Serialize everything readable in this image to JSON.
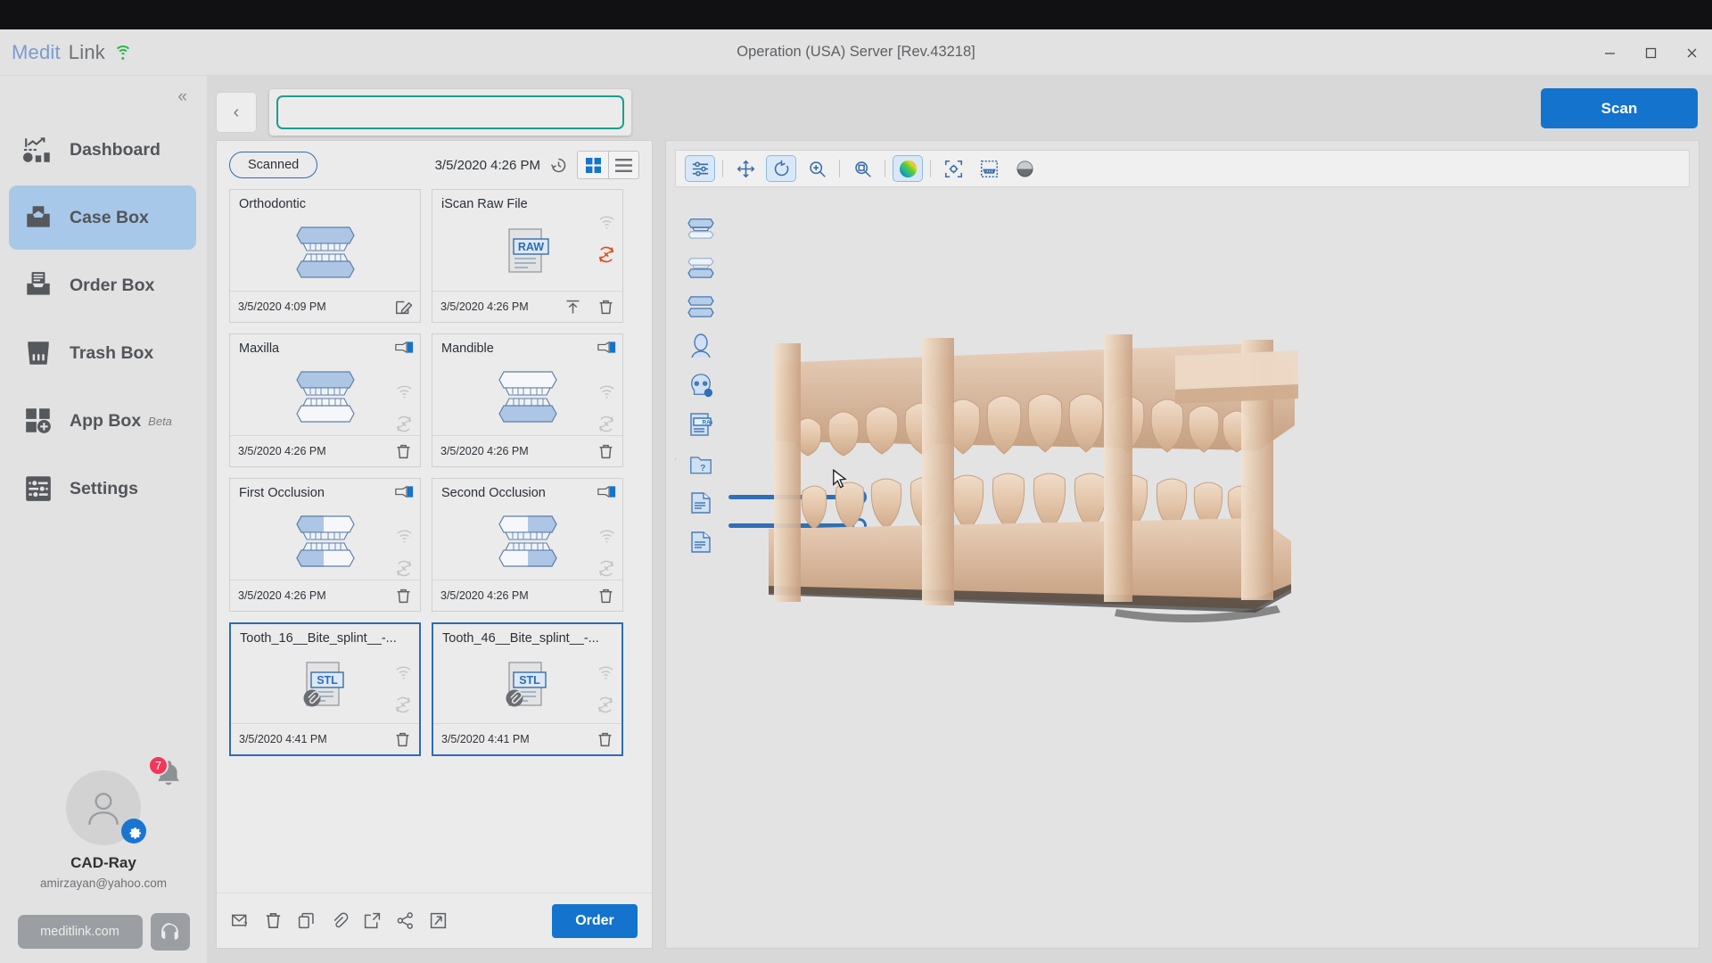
{
  "window": {
    "title": "Operation (USA) Server [Rev.43218]",
    "brand_first": "Medit",
    "brand_second": "Link",
    "wifi_icon": "wifi-icon",
    "minimize_label": "Minimize",
    "maximize_label": "Maximize",
    "close_label": "Close"
  },
  "sidebar": {
    "collapse_glyph": "«",
    "items": [
      {
        "label": "Dashboard",
        "icon": "dashboard-icon",
        "active": false
      },
      {
        "label": "Case Box",
        "icon": "case-box-icon",
        "active": true
      },
      {
        "label": "Order Box",
        "icon": "order-box-icon",
        "active": false
      },
      {
        "label": "Trash Box",
        "icon": "trash-box-icon",
        "active": false
      },
      {
        "label": "App Box",
        "badge": "Beta",
        "icon": "app-box-icon",
        "active": false
      },
      {
        "label": "Settings",
        "icon": "settings-icon",
        "active": false
      }
    ],
    "profile": {
      "name": "CAD-Ray",
      "email": "amirzayan@yahoo.com",
      "avatar_icon": "avatar-icon",
      "gear_icon": "gear-icon",
      "bell_icon": "bell-icon",
      "notification_count": "7",
      "site_button": "meditlink.com",
      "help_icon": "headset-help-icon"
    }
  },
  "topbar": {
    "back_glyph": "‹",
    "search_value": "",
    "search_placeholder": "",
    "scan_button": "Scan"
  },
  "filepanel": {
    "status_pill": "Scanned",
    "date": "3/5/2020 4:26 PM",
    "history_icon": "history-clock-icon",
    "grid_view_icon": "grid-view-icon",
    "list_view_icon": "list-view-icon",
    "active_view": "grid",
    "cards": [
      {
        "title": "Orthodontic",
        "date": "3/5/2020 4:09 PM",
        "thumb": "teeth-both-icon",
        "selected": false,
        "foot_icons": [
          "edit-icon"
        ],
        "side_icons": [],
        "corner_icon": null
      },
      {
        "title": "iScan Raw File",
        "date": "3/5/2020 4:26 PM",
        "thumb": "raw-file-icon",
        "selected": false,
        "foot_icons": [
          "upload-icon",
          "trash-icon"
        ],
        "side_icons": [
          "wifi-off-icon",
          "sync-error-icon"
        ],
        "corner_icon": null
      },
      {
        "title": "Maxilla",
        "date": "3/5/2020 4:26 PM",
        "thumb": "teeth-upper-icon",
        "selected": false,
        "foot_icons": [
          "trash-icon"
        ],
        "side_icons": [
          "wifi-off-icon",
          "sync-off-icon"
        ],
        "corner_icon": "scanner-icon"
      },
      {
        "title": "Mandible",
        "date": "3/5/2020 4:26 PM",
        "thumb": "teeth-lower-icon",
        "selected": false,
        "foot_icons": [
          "trash-icon"
        ],
        "side_icons": [
          "wifi-off-icon",
          "sync-off-icon"
        ],
        "corner_icon": "scanner-icon"
      },
      {
        "title": "First Occlusion",
        "date": "3/5/2020 4:26 PM",
        "thumb": "teeth-occlusion-left-icon",
        "selected": false,
        "foot_icons": [
          "trash-icon"
        ],
        "side_icons": [
          "wifi-off-icon",
          "sync-off-icon"
        ],
        "corner_icon": "scanner-icon"
      },
      {
        "title": "Second Occlusion",
        "date": "3/5/2020 4:26 PM",
        "thumb": "teeth-occlusion-right-icon",
        "selected": false,
        "foot_icons": [
          "trash-icon"
        ],
        "side_icons": [
          "wifi-off-icon",
          "sync-off-icon"
        ],
        "corner_icon": "scanner-icon"
      },
      {
        "title": "Tooth_16__Bite_splint__-...",
        "date": "3/5/2020 4:41 PM",
        "thumb": "stl-file-icon",
        "selected": true,
        "foot_icons": [
          "trash-icon"
        ],
        "side_icons": [
          "wifi-off-icon",
          "sync-off-icon"
        ],
        "corner_icon": null
      },
      {
        "title": "Tooth_46__Bite_splint__-...",
        "date": "3/5/2020 4:41 PM",
        "thumb": "stl-file-icon",
        "selected": true,
        "foot_icons": [
          "trash-icon"
        ],
        "side_icons": [
          "wifi-off-icon",
          "sync-off-icon"
        ],
        "corner_icon": null
      }
    ],
    "footer_icons": [
      "mail-question-icon",
      "trash-icon",
      "copy-icon",
      "attach-icon",
      "export-icon",
      "share-icon",
      "expand-icon"
    ],
    "order_button": "Order"
  },
  "viewer": {
    "toolbar": [
      {
        "icon": "adjust-sliders-icon",
        "active": true
      },
      {
        "icon": "move-icon",
        "active": false
      },
      {
        "icon": "rotate-icon",
        "active": true
      },
      {
        "icon": "zoom-in-icon",
        "active": false
      },
      {
        "icon": "zoom-fit-icon",
        "active": false
      },
      {
        "icon": "color-map-icon",
        "active": true
      },
      {
        "icon": "center-target-icon",
        "active": false
      },
      {
        "icon": "mesh-select-icon",
        "active": false
      },
      {
        "icon": "shading-icon",
        "active": false
      }
    ],
    "rail": [
      {
        "icon": "maxilla-icon"
      },
      {
        "icon": "mandible-icon"
      },
      {
        "icon": "occlusion-icon"
      },
      {
        "icon": "face-scan-icon"
      },
      {
        "icon": "ct-skull-icon"
      },
      {
        "icon": "raw-file-icon"
      },
      {
        "icon": "folder-question-icon"
      },
      {
        "icon": "document-icon"
      },
      {
        "icon": "document-icon"
      }
    ],
    "model_label": "dental-arch-3d-model"
  },
  "colors": {
    "accent_blue": "#1473cc",
    "selection_blue": "#2b6cb8",
    "sidebar_active": "#a8c8ea",
    "focus_teal": "#1d9e8e",
    "badge_red": "#f2385a",
    "wifi_green": "#2db84a",
    "model_beige": "#e2c7ad"
  }
}
